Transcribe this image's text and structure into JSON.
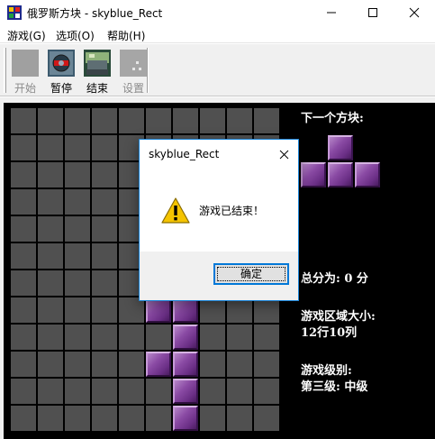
{
  "window": {
    "title": "俄罗斯方块 - skyblue_Rect"
  },
  "menu": {
    "items": [
      {
        "label": "游戏(G)"
      },
      {
        "label": "选项(O)"
      },
      {
        "label": "帮助(H)"
      }
    ]
  },
  "toolbar": {
    "tools": [
      {
        "label": "开始",
        "enabled": false
      },
      {
        "label": "暂停",
        "enabled": true
      },
      {
        "label": "结束",
        "enabled": true
      },
      {
        "label": "设置",
        "enabled": false
      }
    ]
  },
  "side_panel": {
    "next_label": "下一个方块:",
    "score_label": "总分为: 0 分",
    "area_label": "游戏区域大小:",
    "area_value": "12行10列",
    "level_label": "游戏级别:",
    "level_value": "第三级: 中级"
  },
  "board": {
    "rows": 12,
    "cols": 10,
    "cell_color": "#505050",
    "block_color": "#7a3d96",
    "filled_cells": [
      [
        7,
        5
      ],
      [
        7,
        6
      ],
      [
        8,
        6
      ],
      [
        9,
        5
      ],
      [
        9,
        6
      ],
      [
        10,
        6
      ],
      [
        11,
        6
      ]
    ],
    "next_piece": [
      [
        0,
        1
      ],
      [
        1,
        0
      ],
      [
        1,
        1
      ],
      [
        1,
        2
      ]
    ]
  },
  "dialog": {
    "title": "skyblue_Rect",
    "message": "游戏已结束！",
    "ok_label": "确定",
    "icon": "warning-icon"
  }
}
